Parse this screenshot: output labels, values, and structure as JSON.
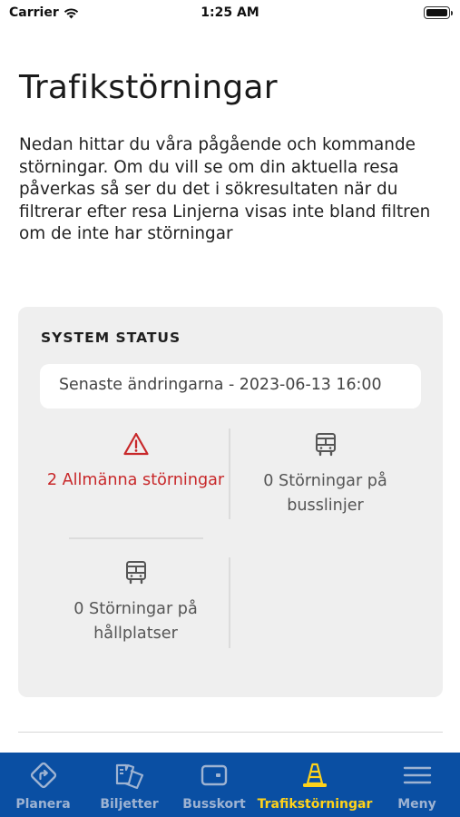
{
  "status_bar": {
    "carrier": "Carrier",
    "time": "1:25 AM"
  },
  "page": {
    "title": "Trafikstörningar",
    "intro": "Nedan hittar du våra pågående och kommande störningar. Om du vill se om din aktuella resa påverkas så ser du det i sökresultaten när du filtrerar efter resa Linjerna visas inte bland filtren om de inte har störningar"
  },
  "system_status": {
    "title": "SYSTEM STATUS",
    "last_changes": "Senaste ändringarna - 2023-06-13 16:00",
    "items": [
      {
        "label": "2 Allmänna störningar",
        "icon": "warning-icon"
      },
      {
        "label": "0 Störningar på busslinjer",
        "icon": "bus-icon"
      },
      {
        "label": "0 Störningar på hållplatser",
        "icon": "bus-icon"
      }
    ]
  },
  "tab_bar": {
    "tabs": [
      {
        "label": "Planera",
        "icon": "route-icon",
        "active": false
      },
      {
        "label": "Biljetter",
        "icon": "tickets-icon",
        "active": false
      },
      {
        "label": "Busskort",
        "icon": "card-icon",
        "active": false
      },
      {
        "label": "Trafikstörningar",
        "icon": "traffic-cone-icon",
        "active": true
      },
      {
        "label": "Meny",
        "icon": "menu-icon",
        "active": false
      }
    ]
  },
  "colors": {
    "brand_blue": "#0a4fa3",
    "active_tab": "#ffd21a",
    "inactive_tab": "#9eb3d2",
    "alert_red": "#c8282a",
    "card_bg": "#efefef"
  }
}
